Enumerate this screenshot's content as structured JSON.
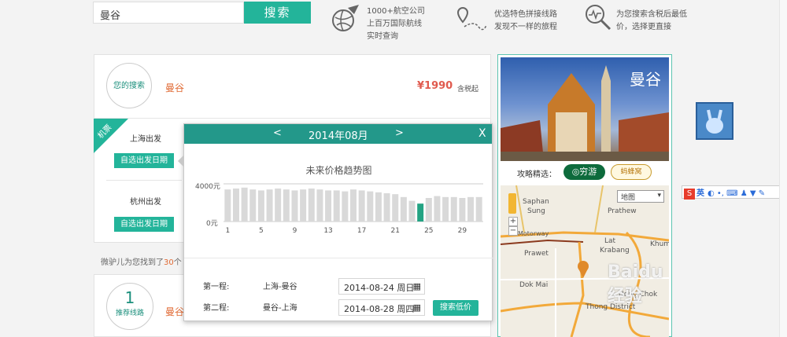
{
  "search": {
    "value": "曼谷",
    "button": "搜索"
  },
  "features": [
    {
      "icon": "globe-plane-icon",
      "lines": [
        "1000+航空公司",
        "上百万国际航线",
        "实时查询"
      ]
    },
    {
      "icon": "route-pin-icon",
      "lines": [
        "优选特色拼接线路",
        "发现不一样的旅程"
      ]
    },
    {
      "icon": "magnifier-chart-icon",
      "lines": [
        "为您搜索含税后最低",
        "价，选择更直接"
      ]
    }
  ],
  "summary": {
    "your_search": "您的搜索",
    "destination": "曼谷",
    "price": "¥1990",
    "price_note": "含税起",
    "ribbon": "机票"
  },
  "origins": [
    {
      "label": "上海出发",
      "button": "自选出发日期"
    },
    {
      "label": "杭州出发",
      "button": "自选出发日期"
    }
  ],
  "found": {
    "prefix": "微驴儿为您找到了",
    "count": "30",
    "suffix": "个"
  },
  "route_card": {
    "number": "1",
    "label": "推荐线路",
    "dest": "曼谷"
  },
  "calendar": {
    "prev": "<",
    "month": "2014年08月",
    "next": ">",
    "close": "X",
    "trend_title": "未来价格趋势图",
    "y_top": "4000元",
    "y_bottom": "0元",
    "x_ticks": [
      "1",
      "5",
      "9",
      "13",
      "17",
      "21",
      "25",
      "29"
    ],
    "legs": [
      {
        "label": "第一程:",
        "route": "上海-曼谷",
        "date": "2014-08-24  周日"
      },
      {
        "label": "第二程:",
        "route": "曼谷-上海",
        "date": "2014-08-28  周四"
      }
    ],
    "search_btn": "搜索低价"
  },
  "chart_data": {
    "type": "bar",
    "title": "未来价格趋势图",
    "categories": [
      "1",
      "2",
      "3",
      "4",
      "5",
      "6",
      "7",
      "8",
      "9",
      "10",
      "11",
      "12",
      "13",
      "14",
      "15",
      "16",
      "17",
      "18",
      "19",
      "20",
      "21",
      "22",
      "23",
      "24",
      "25",
      "26",
      "27",
      "28",
      "29",
      "30",
      "31"
    ],
    "values": [
      3400,
      3500,
      3600,
      3400,
      3300,
      3400,
      3500,
      3400,
      3300,
      3400,
      3500,
      3400,
      3300,
      3300,
      3200,
      3400,
      3300,
      3200,
      3100,
      3000,
      2900,
      2600,
      2200,
      1900,
      2500,
      2700,
      2600,
      2600,
      2500,
      2600,
      2600
    ],
    "highlight_index": 23,
    "ylim": [
      0,
      4000
    ],
    "colors": {
      "bar": "#d9d9d9",
      "highlight": "#23a383"
    }
  },
  "side": {
    "city": "曼谷",
    "guide_label": "攻略精选：",
    "guide_btn1": "穷游",
    "guide_btn2": "蚂蜂窝",
    "map_select": "地图",
    "map_labels": [
      "Saphan",
      "Sung",
      "Prawet",
      "Dok Mai",
      "Lat",
      "Krabang",
      "Khum",
      "Thong District",
      "Motorway",
      "Prathew",
      "Nong Chok"
    ],
    "baidu": "Baidu 经验"
  },
  "ime": {
    "label": "英"
  }
}
